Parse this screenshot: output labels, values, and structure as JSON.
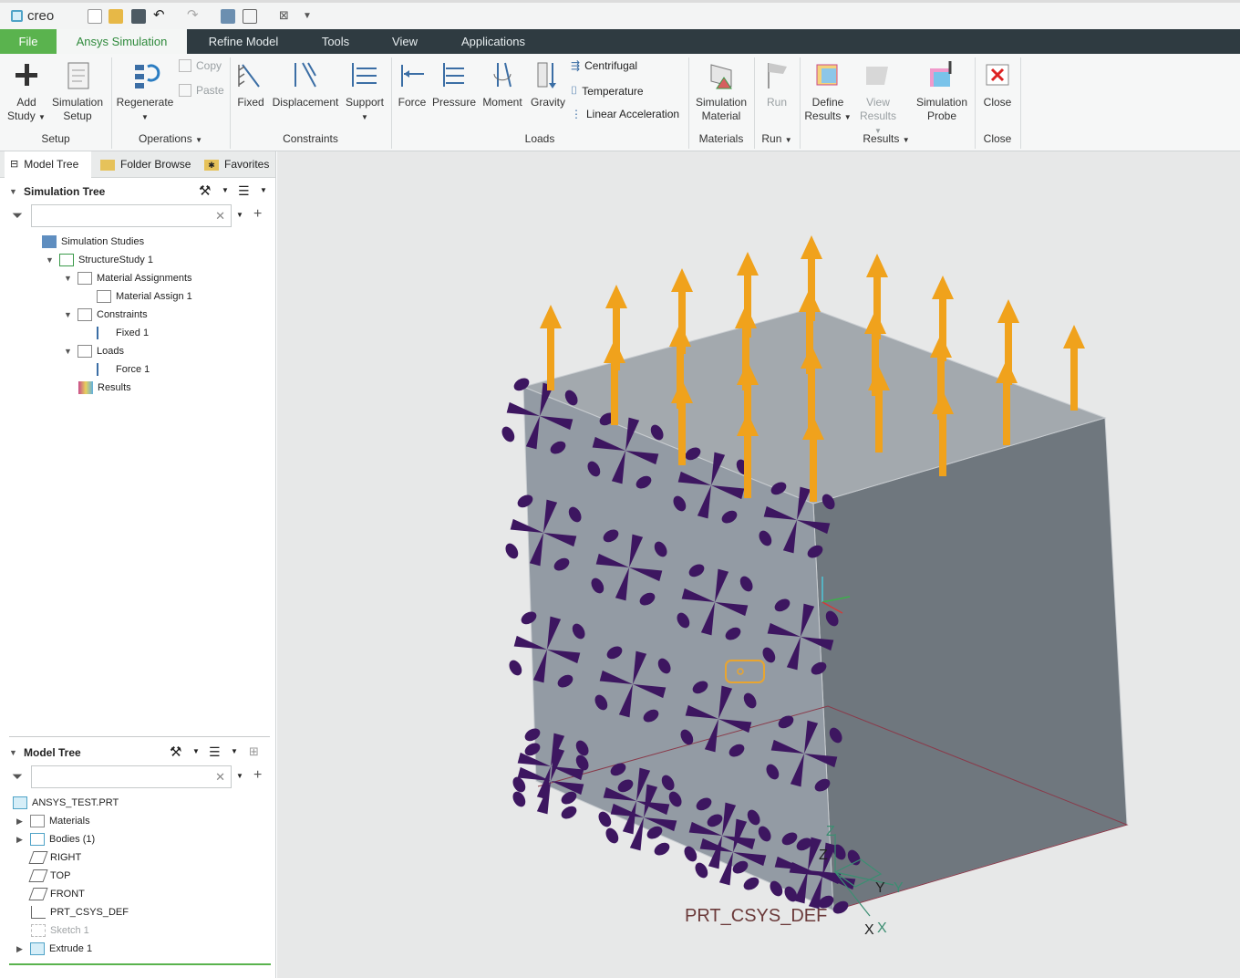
{
  "app": {
    "logo": "creo"
  },
  "menu": {
    "file": "File",
    "tabs": [
      "Ansys Simulation",
      "Refine Model",
      "Tools",
      "View",
      "Applications"
    ]
  },
  "ribbon": {
    "setup": {
      "add_study": "Add Study",
      "simulation_setup": "Simulation Setup",
      "label": "Setup"
    },
    "operations": {
      "regenerate": "Regenerate",
      "copy": "Copy",
      "paste": "Paste",
      "label": "Operations"
    },
    "constraints": {
      "fixed": "Fixed",
      "displacement": "Displacement",
      "support": "Support",
      "label": "Constraints"
    },
    "loads": {
      "force": "Force",
      "pressure": "Pressure",
      "moment": "Moment",
      "gravity": "Gravity",
      "centrifugal": "Centrifugal",
      "temperature": "Temperature",
      "linear_acceleration": "Linear Acceleration",
      "label": "Loads"
    },
    "materials": {
      "simulation_material": "Simulation Material",
      "label": "Materials"
    },
    "run": {
      "run": "Run",
      "label": "Run"
    },
    "results": {
      "define_results": "Define Results",
      "view_results": "View Results",
      "simulation_probe": "Simulation Probe",
      "label": "Results"
    },
    "close": {
      "close": "Close",
      "label": "Close"
    }
  },
  "nav_tabs": [
    "Model Tree",
    "Folder Browse",
    "Favorites"
  ],
  "simulation_tree": {
    "title": "Simulation Tree",
    "filter_placeholder": "",
    "nodes": [
      "Simulation Studies",
      "StructureStudy 1",
      "Material Assignments",
      "Material Assign 1",
      "Constraints",
      "Fixed 1",
      "Loads",
      "Force 1",
      "Results"
    ]
  },
  "model_tree": {
    "title": "Model Tree",
    "filter_placeholder": "",
    "nodes": [
      "ANSYS_TEST.PRT",
      "Materials",
      "Bodies (1)",
      "RIGHT",
      "TOP",
      "FRONT",
      "PRT_CSYS_DEF",
      "Sketch 1",
      "Extrude 1"
    ]
  },
  "viewport": {
    "csys_label": "PRT_CSYS_DEF",
    "axis_z": "Z",
    "axis_y": "Y",
    "axis_x": "X",
    "colors": {
      "body_top": "#a3a9ae",
      "body_front": "#939ba4",
      "body_right": "#6f777e",
      "load_arrow": "#f0a21c",
      "constraint": "#3d1660"
    }
  }
}
